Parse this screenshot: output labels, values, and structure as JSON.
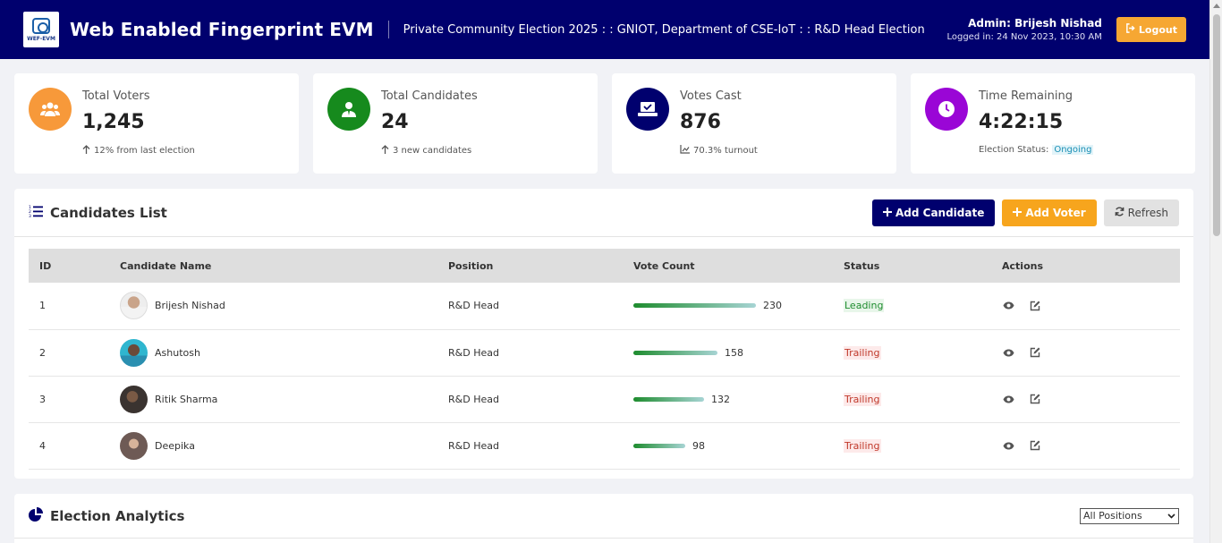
{
  "header": {
    "logo_text": "WEF-EVM",
    "brand": "Web Enabled Fingerprint EVM",
    "subtitle": "Private Community Election 2025 : : GNIOT, Department of CSE-IoT : : R&D Head Election",
    "admin": "Admin: Brijesh Nishad",
    "logged_in": "Logged in: 24 Nov 2023, 10:30 AM",
    "logout_label": "Logout"
  },
  "stats": [
    {
      "label": "Total Voters",
      "value": "1,245",
      "note": "12% from last election",
      "icon": "users-icon",
      "color": "#f7993a"
    },
    {
      "label": "Total Candidates",
      "value": "24",
      "note": "3 new candidates",
      "icon": "user-tie-icon",
      "color": "#168a1d"
    },
    {
      "label": "Votes Cast",
      "value": "876",
      "note": "70.3% turnout",
      "icon": "vote-box-icon",
      "color": "#00006e"
    },
    {
      "label": "Time Remaining",
      "value": "4:22:15",
      "note_prefix": "Election Status:",
      "status": "Ongoing",
      "icon": "clock-icon",
      "color": "#9a06d6"
    }
  ],
  "candidates_panel": {
    "title": "Candidates List",
    "add_candidate": "Add Candidate",
    "add_voter": "Add Voter",
    "refresh": "Refresh",
    "columns": [
      "ID",
      "Candidate Name",
      "Position",
      "Vote Count",
      "Status",
      "Actions"
    ],
    "rows": [
      {
        "id": "1",
        "name": "Brijesh Nishad",
        "position": "R&D Head",
        "votes": "230",
        "vote_fraction": 1.0,
        "status": "Leading"
      },
      {
        "id": "2",
        "name": "Ashutosh",
        "position": "R&D Head",
        "votes": "158",
        "vote_fraction": 0.687,
        "status": "Trailing"
      },
      {
        "id": "3",
        "name": "Ritik Sharma",
        "position": "R&D Head",
        "votes": "132",
        "vote_fraction": 0.574,
        "status": "Trailing"
      },
      {
        "id": "4",
        "name": "Deepika",
        "position": "R&D Head",
        "votes": "98",
        "vote_fraction": 0.426,
        "status": "Trailing"
      }
    ]
  },
  "analytics_panel": {
    "title": "Election Analytics",
    "filter_value": "All Positions"
  }
}
